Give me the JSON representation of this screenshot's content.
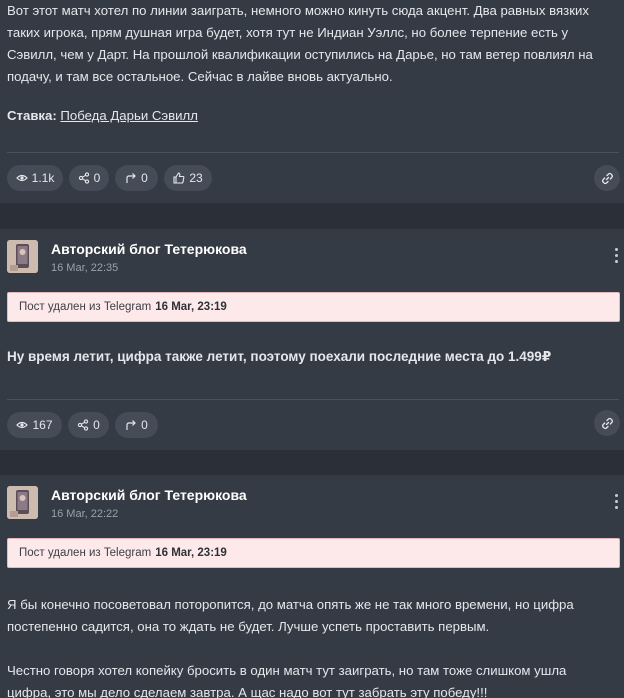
{
  "post1": {
    "body": "Вот этот матч хотел по линии заиграть, немного можно кинуть сюда акцент. Два равных вязких таких игрока, прям душная игра будет, хотя тут не Индиан Уэллс, но более терпение есть у Сэвилл, чем у Дарт. На прошлой квалификации оступились на Дарье, но там ветер повлиял на подачу, и там все остальное. Сейчас в лайве вновь актуально.",
    "stake_label": "Ставка:",
    "stake_value": "Победа Дарьи Сэвилл",
    "stats": {
      "views": "1.1k",
      "shares": "0",
      "reposts": "0",
      "likes": "23"
    }
  },
  "post2": {
    "author": "Авторский блог Тетерюкова",
    "date": "16 Mar, 22:35",
    "deleted_prefix": "Пост удален из Telegram",
    "deleted_date": "16 Mar, 23:19",
    "body": "Ну время летит, цифра также летит, поэтому поехали последние места до 1.499₽",
    "stats": {
      "views": "167",
      "shares": "0",
      "reposts": "0"
    }
  },
  "post3": {
    "author": "Авторский блог Тетерюкова",
    "date": "16 Mar, 22:22",
    "deleted_prefix": "Пост удален из Telegram",
    "deleted_date": "16 Mar, 23:19",
    "body_p1": "Я бы конечно посоветовал поторопится, до матча опять же не так много времени, но цифра постепенно садится, она то ждать не будет. Лучше успеть проставить первым.",
    "body_p2": "Честно говоря хотел копейку бросить в один матч тут заиграть, но там тоже слишком ушла цифра, это мы дело сделаем завтра. А щас надо вот тут забрать эту победу!!!"
  },
  "icons": {
    "views": "eye-icon",
    "shares": "share-icon",
    "reposts": "repost-arrow-icon",
    "likes": "thumbs-up-icon",
    "link": "link-icon",
    "menu": "kebab-menu-icon"
  },
  "colors": {
    "page_bg": "#2b3038",
    "card_bg": "#353b44",
    "pill_bg": "#454c57",
    "deleted_bg": "#fde9ea",
    "deleted_border": "#e6b9bc"
  }
}
